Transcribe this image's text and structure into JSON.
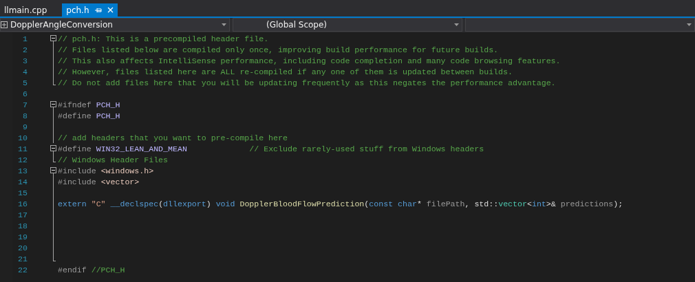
{
  "tabs": [
    {
      "label": "llmain.cpp",
      "selected": false
    },
    {
      "label": "pch.h",
      "selected": true
    }
  ],
  "navigation": [
    {
      "text": "DopplerAngleConversion",
      "kind": "project"
    },
    {
      "text": "(Global Scope)",
      "kind": "scope"
    },
    {
      "kind": "member"
    }
  ],
  "lines": [
    {
      "number": "1",
      "kind": "fold-start",
      "expanded": true,
      "tokens": [
        {
          "kind": "comment",
          "text": "// pch.h: This is a precompiled header file."
        }
      ]
    },
    {
      "number": "2",
      "kind": "fold-body",
      "tokens": [
        {
          "kind": "comment",
          "text": "// Files listed below are compiled only once, improving build performance for future builds."
        }
      ]
    },
    {
      "number": "3",
      "kind": "fold-body",
      "tokens": [
        {
          "kind": "comment",
          "text": "// This also affects IntelliSense performance, including code completion and many code browsing features."
        }
      ]
    },
    {
      "number": "4",
      "kind": "fold-body",
      "tokens": [
        {
          "kind": "comment",
          "text": "// However, files listed here are ALL re-compiled if any one of them is updated between builds."
        }
      ]
    },
    {
      "number": "5",
      "kind": "fold-end",
      "tokens": [
        {
          "kind": "comment",
          "text": "// Do not add files here that you will be updating frequently as this negates the performance advantage."
        }
      ]
    },
    {
      "number": "6",
      "kind": "plain"
    },
    {
      "number": "7",
      "kind": "fold-start",
      "expanded": true,
      "tokens": [
        {
          "kind": "preprocessor",
          "text": "#ifndef "
        },
        {
          "kind": "macro",
          "text": "PCH_H"
        }
      ]
    },
    {
      "number": "8",
      "kind": "fold-body",
      "tokens": [
        {
          "kind": "preprocessor",
          "text": "#define "
        },
        {
          "kind": "macro",
          "text": "PCH_H"
        }
      ]
    },
    {
      "number": "9",
      "kind": "fold-body"
    },
    {
      "number": "10",
      "kind": "fold-body",
      "tokens": [
        {
          "kind": "comment",
          "text": "// add headers that you want to pre-compile here"
        }
      ]
    },
    {
      "number": "11",
      "kind": "fold-start",
      "expanded": true,
      "tokens": [
        {
          "kind": "preprocessor",
          "text": "#define "
        },
        {
          "kind": "macro",
          "text": "WIN32_LEAN_AND_MEAN             "
        },
        {
          "kind": "comment",
          "text": "// Exclude rarely-used stuff from Windows headers"
        }
      ]
    },
    {
      "number": "12",
      "kind": "fold-end",
      "tokens": [
        {
          "kind": "comment",
          "text": "// Windows Header Files"
        }
      ]
    },
    {
      "number": "13",
      "kind": "fold-start",
      "expanded": true,
      "tokens": [
        {
          "kind": "preprocessor",
          "text": "#include "
        },
        {
          "kind": "path",
          "text": "<windows.h>"
        }
      ]
    },
    {
      "number": "14",
      "kind": "fold-body",
      "tokens": [
        {
          "kind": "preprocessor",
          "text": "#include "
        },
        {
          "kind": "path",
          "text": "<vector>"
        }
      ]
    },
    {
      "number": "15",
      "kind": "fold-body"
    },
    {
      "number": "16",
      "kind": "fold-body",
      "tokens": [
        {
          "kind": "keyword",
          "text": "extern "
        },
        {
          "kind": "string",
          "text": "\"C\" "
        },
        {
          "kind": "keyword",
          "text": "__declspec"
        },
        {
          "kind": "plain",
          "text": "("
        },
        {
          "kind": "keyword",
          "text": "dllexport"
        },
        {
          "kind": "plain",
          "text": ") "
        },
        {
          "kind": "keyword",
          "text": "void "
        },
        {
          "kind": "function",
          "text": "DopplerBloodFlowPrediction"
        },
        {
          "kind": "plain",
          "text": "("
        },
        {
          "kind": "keyword",
          "text": "const "
        },
        {
          "kind": "keyword",
          "text": "char"
        },
        {
          "kind": "plain",
          "text": "* "
        },
        {
          "kind": "parameter",
          "text": "filePath"
        },
        {
          "kind": "plain",
          "text": ", std::"
        },
        {
          "kind": "type",
          "text": "vector"
        },
        {
          "kind": "plain",
          "text": "<"
        },
        {
          "kind": "keyword",
          "text": "int"
        },
        {
          "kind": "plain",
          "text": ">& "
        },
        {
          "kind": "parameter",
          "text": "predictions"
        },
        {
          "kind": "plain",
          "text": ");"
        }
      ]
    },
    {
      "number": "17",
      "kind": "fold-body"
    },
    {
      "number": "18",
      "kind": "fold-body"
    },
    {
      "number": "19",
      "kind": "fold-body"
    },
    {
      "number": "20",
      "kind": "fold-body"
    },
    {
      "number": "21",
      "kind": "fold-end"
    },
    {
      "number": "22",
      "kind": "plain",
      "tokens": [
        {
          "kind": "preprocessor",
          "text": "#endif "
        },
        {
          "kind": "comment",
          "text": "//PCH_H"
        }
      ]
    }
  ]
}
